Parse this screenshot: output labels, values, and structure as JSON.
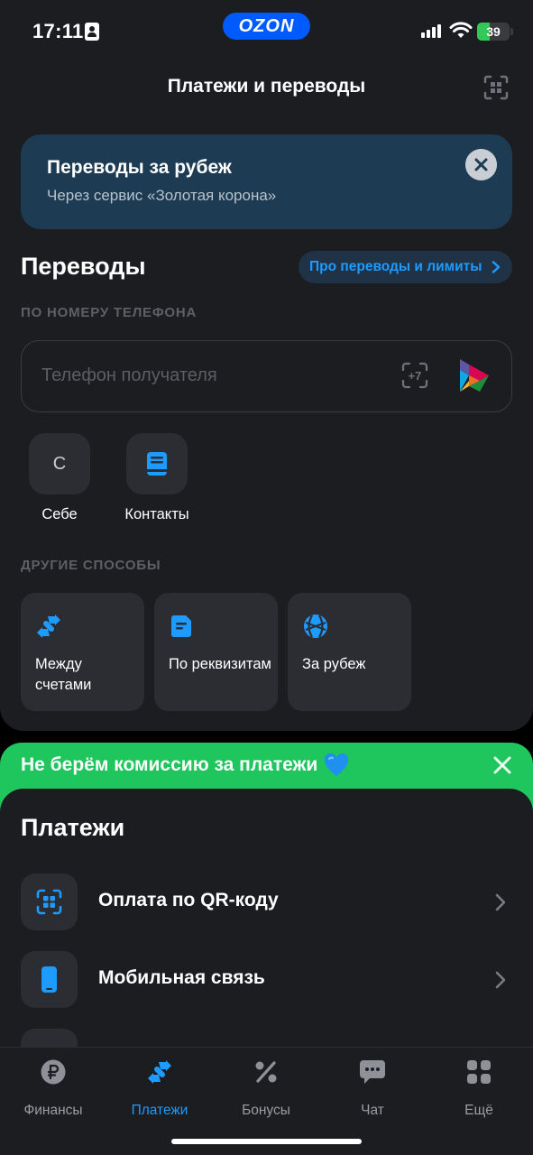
{
  "status_bar": {
    "time": "17:11",
    "carrier_logo": "OZON",
    "battery": "39",
    "battery_level": 0.39,
    "battery_color": "#34c759"
  },
  "header": {
    "title": "Платежи и переводы",
    "right_icon": "qr-scan-icon"
  },
  "banner": {
    "title": "Переводы за рубеж",
    "subtitle": "Через сервис «Золотая корона»",
    "close_icon": "close-icon"
  },
  "transfers": {
    "title": "Переводы",
    "limits_link": "Про переводы и лимиты",
    "phone_caption": "ПО НОМЕРУ ТЕЛЕФОНА",
    "phone_placeholder": "Телефон получателя",
    "quick": [
      {
        "label": "Себе",
        "letter": "С"
      },
      {
        "label": "Контакты",
        "icon": "contacts-book-icon"
      }
    ],
    "other_caption": "ДРУГИЕ СПОСОБЫ",
    "methods": [
      {
        "label": "Между счетами",
        "icon": "swap-arrows-icon"
      },
      {
        "label": "По реквизитам",
        "icon": "document-icon"
      },
      {
        "label": "За рубеж",
        "icon": "globe-icon"
      }
    ]
  },
  "promo": {
    "text": "Не берём комиссию за платежи",
    "emoji": "blue-heart-icon",
    "color": "#1fc55d"
  },
  "payments": {
    "title": "Платежи",
    "items": [
      {
        "label": "Оплата по QR-коду",
        "icon": "qr-code-icon"
      },
      {
        "label": "Мобильная связь",
        "icon": "mobile-phone-icon"
      }
    ]
  },
  "tabbar": {
    "items": [
      {
        "label": "Финансы",
        "icon": "ruble-icon",
        "active": false
      },
      {
        "label": "Платежи",
        "icon": "swap-arrows-icon",
        "active": true
      },
      {
        "label": "Бонусы",
        "icon": "percent-icon",
        "active": false
      },
      {
        "label": "Чат",
        "icon": "chat-icon",
        "active": false
      },
      {
        "label": "Ещё",
        "icon": "grid-icon",
        "active": false
      }
    ]
  },
  "colors": {
    "accent": "#1e9bff",
    "background": "#1c1d21",
    "tile": "#2c2d32",
    "banner": "#1d3b52"
  }
}
